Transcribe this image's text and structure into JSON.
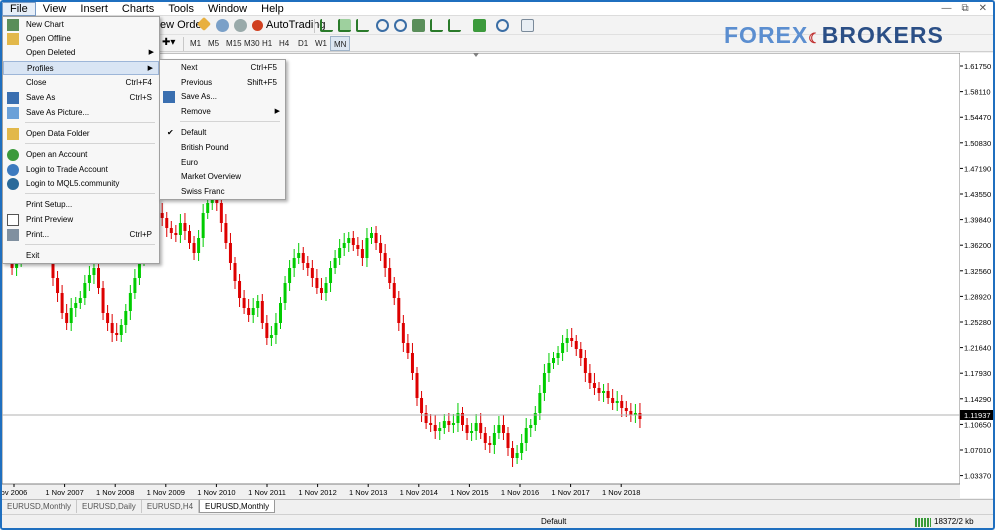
{
  "menubar": {
    "items": [
      "File",
      "View",
      "Insert",
      "Charts",
      "Tools",
      "Window",
      "Help"
    ]
  },
  "window_controls": [
    "minimize-icon",
    "restore-icon",
    "close-icon"
  ],
  "toolbar": {
    "new_order_label": "ew Order",
    "autotrading_label": "AutoTrading",
    "timeframes": [
      "M1",
      "M5",
      "M15",
      "M30",
      "H1",
      "H4",
      "D1",
      "W1",
      "MN"
    ],
    "selected_timeframe": "MN"
  },
  "logo": {
    "part1": "FOREX",
    "part2": "BROKERS",
    "suffix": ".NET"
  },
  "file_menu": {
    "items": [
      {
        "label": "New Chart",
        "shortcut": "",
        "icon": "new-chart-icon"
      },
      {
        "label": "Open Offline",
        "shortcut": "",
        "icon": "open-offline-icon"
      },
      {
        "label": "Open Deleted",
        "shortcut": "",
        "submenu": true
      },
      {
        "label": "Profiles",
        "shortcut": "",
        "submenu": true,
        "highlighted": true
      },
      {
        "label": "Close",
        "shortcut": "Ctrl+F4"
      },
      {
        "label": "Save As",
        "shortcut": "Ctrl+S",
        "icon": "save-icon"
      },
      {
        "label": "Save As Picture...",
        "shortcut": "",
        "icon": "picture-icon"
      },
      {
        "label": "Open Data Folder",
        "shortcut": "",
        "icon": "folder-icon"
      },
      {
        "label": "Open an Account",
        "shortcut": "",
        "icon": "account-icon"
      },
      {
        "label": "Login to Trade Account",
        "shortcut": "",
        "icon": "login-icon"
      },
      {
        "label": "Login to MQL5.community",
        "shortcut": "",
        "icon": "mql5-icon"
      },
      {
        "label": "Print Setup...",
        "shortcut": ""
      },
      {
        "label": "Print Preview",
        "shortcut": "",
        "icon": "print-preview-icon"
      },
      {
        "label": "Print...",
        "shortcut": "Ctrl+P",
        "icon": "printer-icon"
      },
      {
        "label": "Exit",
        "shortcut": ""
      }
    ]
  },
  "profiles_menu": {
    "items": [
      {
        "label": "Next",
        "shortcut": "Ctrl+F5"
      },
      {
        "label": "Previous",
        "shortcut": "Shift+F5"
      },
      {
        "label": "Save As...",
        "shortcut": "",
        "icon": "save-profile-icon"
      },
      {
        "label": "Remove",
        "shortcut": "",
        "submenu": true
      },
      {
        "label": "Default",
        "checked": true
      },
      {
        "label": "British Pound"
      },
      {
        "label": "Euro"
      },
      {
        "label": "Market Overview"
      },
      {
        "label": "Swiss Franc"
      }
    ]
  },
  "chart": {
    "current_price": "1.11937",
    "price_axis": [
      "1.61750",
      "1.58110",
      "1.54470",
      "1.50830",
      "1.47190",
      "1.43550",
      "1.39840",
      "1.36200",
      "1.32560",
      "1.28920",
      "1.25280",
      "1.21640",
      "1.17930",
      "1.14290",
      "1.10650",
      "1.07010",
      "1.03370"
    ],
    "time_axis": [
      "ov 2006",
      "1 Nov 2007",
      "1 Nov 2008",
      "1 Nov 2009",
      "1 Nov 2010",
      "1 Nov 2011",
      "1 Nov 2012",
      "1 Nov 2013",
      "1 Nov 2014",
      "1 Nov 2015",
      "1 Nov 2016",
      "1 Nov 2017",
      "1 Nov 2018"
    ],
    "bull_color": "#00cc00",
    "bear_color": "#dd0000"
  },
  "tabs": {
    "items": [
      "EURUSD,Monthly",
      "EURUSD,Daily",
      "EURUSD,H4",
      "EURUSD,Monthly"
    ],
    "active_index": 3
  },
  "status": {
    "profile": "Default",
    "traffic": "18372/2 kb"
  }
}
